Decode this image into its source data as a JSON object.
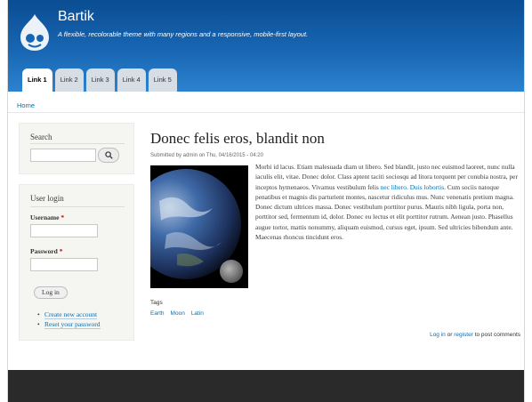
{
  "header": {
    "site_name": "Bartik",
    "slogan": "A flexible, recolorable theme with many regions and a responsive, mobile-first layout.",
    "tabs": [
      "Link 1",
      "Link 2",
      "Link 3",
      "Link 4",
      "Link 5"
    ],
    "active_tab": 0
  },
  "breadcrumb": "Home",
  "sidebar": {
    "search": {
      "title": "Search",
      "value": "",
      "icon": "search-icon"
    },
    "login": {
      "title": "User login",
      "username_label": "Username",
      "password_label": "Password",
      "required_mark": "*",
      "username_value": "",
      "password_value": "",
      "login_button": "Log in",
      "links": [
        "Create new account",
        "Reset your password"
      ]
    }
  },
  "article": {
    "title": "Donec felis eros, blandit non",
    "submitted": "Submitted by admin on Thu, 04/16/2015 - 04:20",
    "body_before_link": "Morbi id lacus. Etiam malesuada diam ut libero. Sed blandit, justo nec euismod laoreet, nunc nulla iaculis elit, vitae. Donec dolor. Class aptent taciti sociosqu ad litora torquent per conubia nostra, per inceptos hymenaeos. Vivamus vestibulum felis ",
    "body_link": "nec libero. Duis lobortis",
    "body_after_link": ". Cum sociis natoque penatibus et magnis dis parturient montes, nascetur ridiculus mus. Nunc venenatis pretium magna. Donec dictum ultrices massa. Donec vestibulum porttitor purus. Mauris nibh ligula, porta non, porttitor sed, fermentum id, dolor. Donec eu lectus et elit porttitor rutrum. Aenean justo. Phasellus augue tortor, mattis nonummy, aliquam euismod, cursus eget, ipsum. Sed ultricies bibendum ante. Maecenas rhoncus tincidunt eros.",
    "tags_label": "Tags",
    "tags": [
      "Earth",
      "Moon",
      "Latin"
    ],
    "comment_login": "Log in",
    "comment_or": " or ",
    "comment_register": "register",
    "comment_suffix": " to post comments"
  },
  "colors": {
    "header_top": "#0a4d93",
    "header_bottom": "#2c83cf",
    "link": "#0071b3",
    "footer": "#2a2a2a"
  }
}
